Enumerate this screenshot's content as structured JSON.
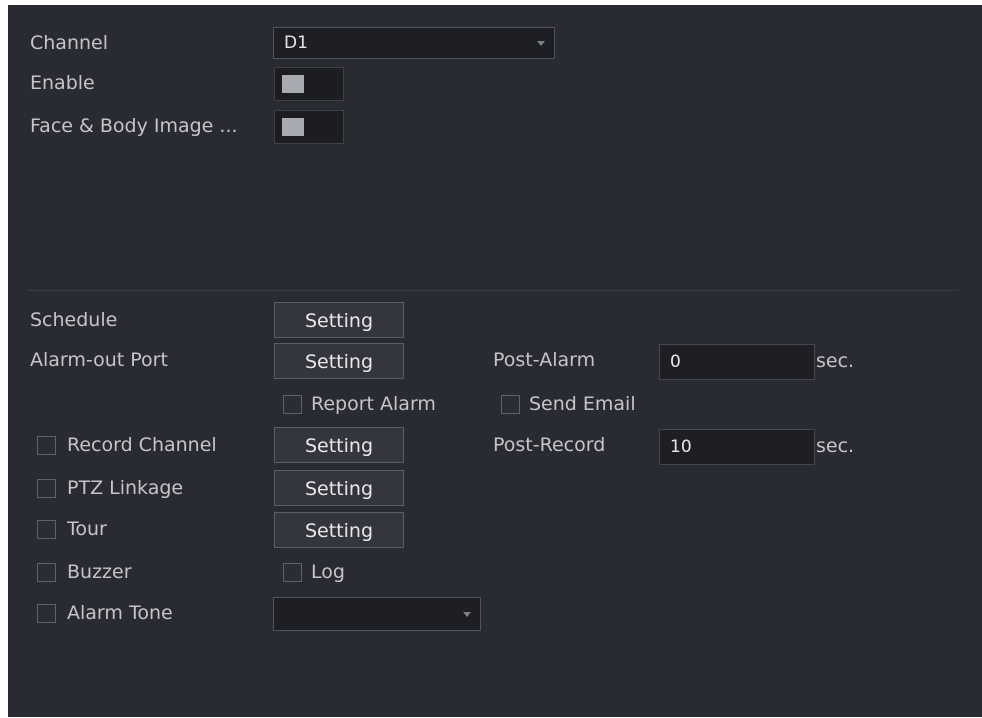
{
  "channel": {
    "label": "Channel",
    "value": "D1"
  },
  "enable": {
    "label": "Enable",
    "on": false
  },
  "face_body": {
    "label": "Face & Body Image ...",
    "on": false
  },
  "schedule": {
    "label": "Schedule",
    "button": "Setting"
  },
  "alarm_out": {
    "label": "Alarm-out Port",
    "button": "Setting",
    "post_alarm_label": "Post-Alarm",
    "post_alarm_value": "0",
    "unit": "sec."
  },
  "report_alarm": {
    "label": "Report Alarm",
    "checked": false
  },
  "send_email": {
    "label": "Send Email",
    "checked": false
  },
  "record_channel": {
    "label": "Record Channel",
    "checked": false,
    "button": "Setting",
    "post_record_label": "Post-Record",
    "post_record_value": "10",
    "unit": "sec."
  },
  "ptz_linkage": {
    "label": "PTZ Linkage",
    "checked": false,
    "button": "Setting"
  },
  "tour": {
    "label": "Tour",
    "checked": false,
    "button": "Setting"
  },
  "buzzer": {
    "label": "Buzzer",
    "checked": false
  },
  "log": {
    "label": "Log",
    "checked": false
  },
  "alarm_tone": {
    "label": "Alarm Tone",
    "checked": false,
    "value": ""
  },
  "colors": {
    "panel": "#282b31",
    "text": "#c3c5c9",
    "field": "#1d1f24"
  }
}
